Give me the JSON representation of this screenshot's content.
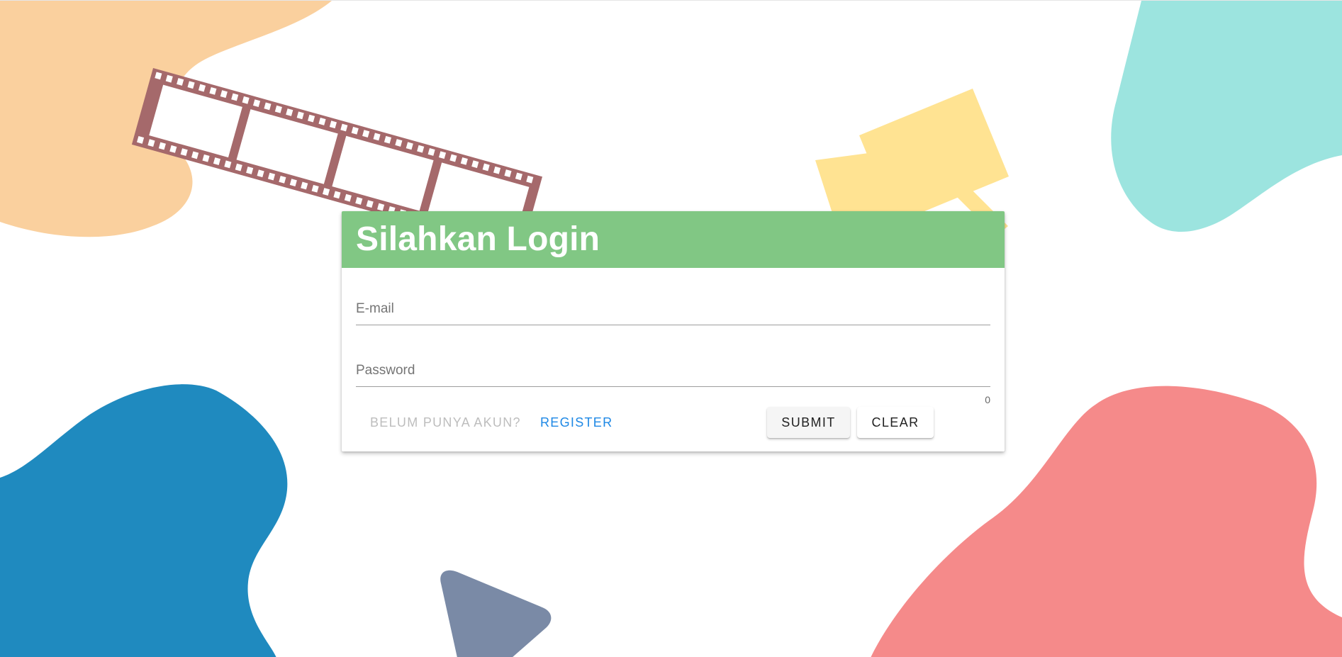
{
  "login_card": {
    "title": "Silahkan Login",
    "email_label": "E-mail",
    "password_label": "Password",
    "password_counter": "0",
    "no_account_label": "BELUM PUNYA AKUN?",
    "register_label": "REGISTER",
    "submit_label": "SUBMIT",
    "clear_label": "CLEAR"
  },
  "colors": {
    "header_green": "#81c784",
    "link_blue": "#1e88e5",
    "blob_orange": "#fad09e",
    "blob_teal": "#9ce4df",
    "blob_blue": "#1f8abf",
    "blob_pink": "#f58a8a",
    "film_strip": "#a5696b",
    "camera_yellow": "#ffe392",
    "play_slate": "#7a8aa6"
  },
  "decorations": {
    "icons": [
      "film-strip-icon",
      "movie-camera-icon",
      "play-icon"
    ]
  }
}
